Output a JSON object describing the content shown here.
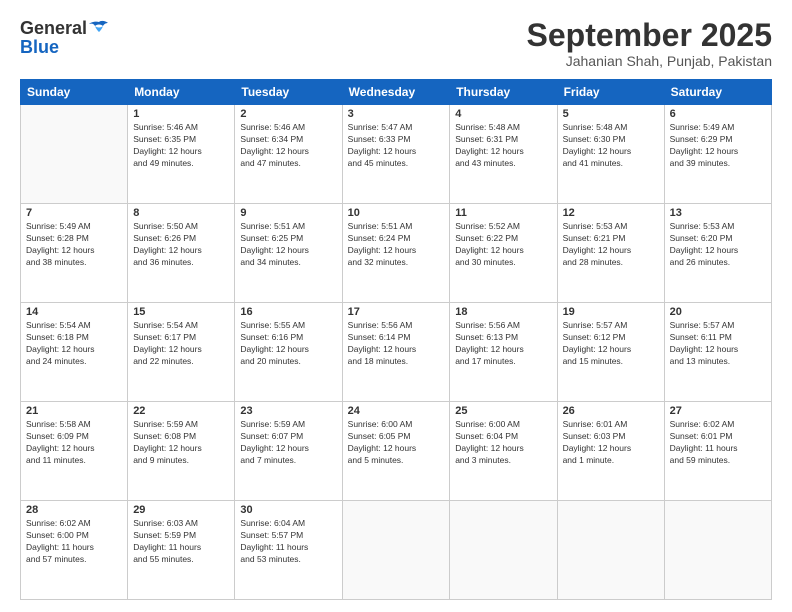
{
  "logo": {
    "general": "General",
    "blue": "Blue"
  },
  "header": {
    "month": "September 2025",
    "location": "Jahanian Shah, Punjab, Pakistan"
  },
  "weekdays": [
    "Sunday",
    "Monday",
    "Tuesday",
    "Wednesday",
    "Thursday",
    "Friday",
    "Saturday"
  ],
  "weeks": [
    [
      {
        "day": "",
        "info": ""
      },
      {
        "day": "1",
        "info": "Sunrise: 5:46 AM\nSunset: 6:35 PM\nDaylight: 12 hours\nand 49 minutes."
      },
      {
        "day": "2",
        "info": "Sunrise: 5:46 AM\nSunset: 6:34 PM\nDaylight: 12 hours\nand 47 minutes."
      },
      {
        "day": "3",
        "info": "Sunrise: 5:47 AM\nSunset: 6:33 PM\nDaylight: 12 hours\nand 45 minutes."
      },
      {
        "day": "4",
        "info": "Sunrise: 5:48 AM\nSunset: 6:31 PM\nDaylight: 12 hours\nand 43 minutes."
      },
      {
        "day": "5",
        "info": "Sunrise: 5:48 AM\nSunset: 6:30 PM\nDaylight: 12 hours\nand 41 minutes."
      },
      {
        "day": "6",
        "info": "Sunrise: 5:49 AM\nSunset: 6:29 PM\nDaylight: 12 hours\nand 39 minutes."
      }
    ],
    [
      {
        "day": "7",
        "info": "Sunrise: 5:49 AM\nSunset: 6:28 PM\nDaylight: 12 hours\nand 38 minutes."
      },
      {
        "day": "8",
        "info": "Sunrise: 5:50 AM\nSunset: 6:26 PM\nDaylight: 12 hours\nand 36 minutes."
      },
      {
        "day": "9",
        "info": "Sunrise: 5:51 AM\nSunset: 6:25 PM\nDaylight: 12 hours\nand 34 minutes."
      },
      {
        "day": "10",
        "info": "Sunrise: 5:51 AM\nSunset: 6:24 PM\nDaylight: 12 hours\nand 32 minutes."
      },
      {
        "day": "11",
        "info": "Sunrise: 5:52 AM\nSunset: 6:22 PM\nDaylight: 12 hours\nand 30 minutes."
      },
      {
        "day": "12",
        "info": "Sunrise: 5:53 AM\nSunset: 6:21 PM\nDaylight: 12 hours\nand 28 minutes."
      },
      {
        "day": "13",
        "info": "Sunrise: 5:53 AM\nSunset: 6:20 PM\nDaylight: 12 hours\nand 26 minutes."
      }
    ],
    [
      {
        "day": "14",
        "info": "Sunrise: 5:54 AM\nSunset: 6:18 PM\nDaylight: 12 hours\nand 24 minutes."
      },
      {
        "day": "15",
        "info": "Sunrise: 5:54 AM\nSunset: 6:17 PM\nDaylight: 12 hours\nand 22 minutes."
      },
      {
        "day": "16",
        "info": "Sunrise: 5:55 AM\nSunset: 6:16 PM\nDaylight: 12 hours\nand 20 minutes."
      },
      {
        "day": "17",
        "info": "Sunrise: 5:56 AM\nSunset: 6:14 PM\nDaylight: 12 hours\nand 18 minutes."
      },
      {
        "day": "18",
        "info": "Sunrise: 5:56 AM\nSunset: 6:13 PM\nDaylight: 12 hours\nand 17 minutes."
      },
      {
        "day": "19",
        "info": "Sunrise: 5:57 AM\nSunset: 6:12 PM\nDaylight: 12 hours\nand 15 minutes."
      },
      {
        "day": "20",
        "info": "Sunrise: 5:57 AM\nSunset: 6:11 PM\nDaylight: 12 hours\nand 13 minutes."
      }
    ],
    [
      {
        "day": "21",
        "info": "Sunrise: 5:58 AM\nSunset: 6:09 PM\nDaylight: 12 hours\nand 11 minutes."
      },
      {
        "day": "22",
        "info": "Sunrise: 5:59 AM\nSunset: 6:08 PM\nDaylight: 12 hours\nand 9 minutes."
      },
      {
        "day": "23",
        "info": "Sunrise: 5:59 AM\nSunset: 6:07 PM\nDaylight: 12 hours\nand 7 minutes."
      },
      {
        "day": "24",
        "info": "Sunrise: 6:00 AM\nSunset: 6:05 PM\nDaylight: 12 hours\nand 5 minutes."
      },
      {
        "day": "25",
        "info": "Sunrise: 6:00 AM\nSunset: 6:04 PM\nDaylight: 12 hours\nand 3 minutes."
      },
      {
        "day": "26",
        "info": "Sunrise: 6:01 AM\nSunset: 6:03 PM\nDaylight: 12 hours\nand 1 minute."
      },
      {
        "day": "27",
        "info": "Sunrise: 6:02 AM\nSunset: 6:01 PM\nDaylight: 11 hours\nand 59 minutes."
      }
    ],
    [
      {
        "day": "28",
        "info": "Sunrise: 6:02 AM\nSunset: 6:00 PM\nDaylight: 11 hours\nand 57 minutes."
      },
      {
        "day": "29",
        "info": "Sunrise: 6:03 AM\nSunset: 5:59 PM\nDaylight: 11 hours\nand 55 minutes."
      },
      {
        "day": "30",
        "info": "Sunrise: 6:04 AM\nSunset: 5:57 PM\nDaylight: 11 hours\nand 53 minutes."
      },
      {
        "day": "",
        "info": ""
      },
      {
        "day": "",
        "info": ""
      },
      {
        "day": "",
        "info": ""
      },
      {
        "day": "",
        "info": ""
      }
    ]
  ]
}
